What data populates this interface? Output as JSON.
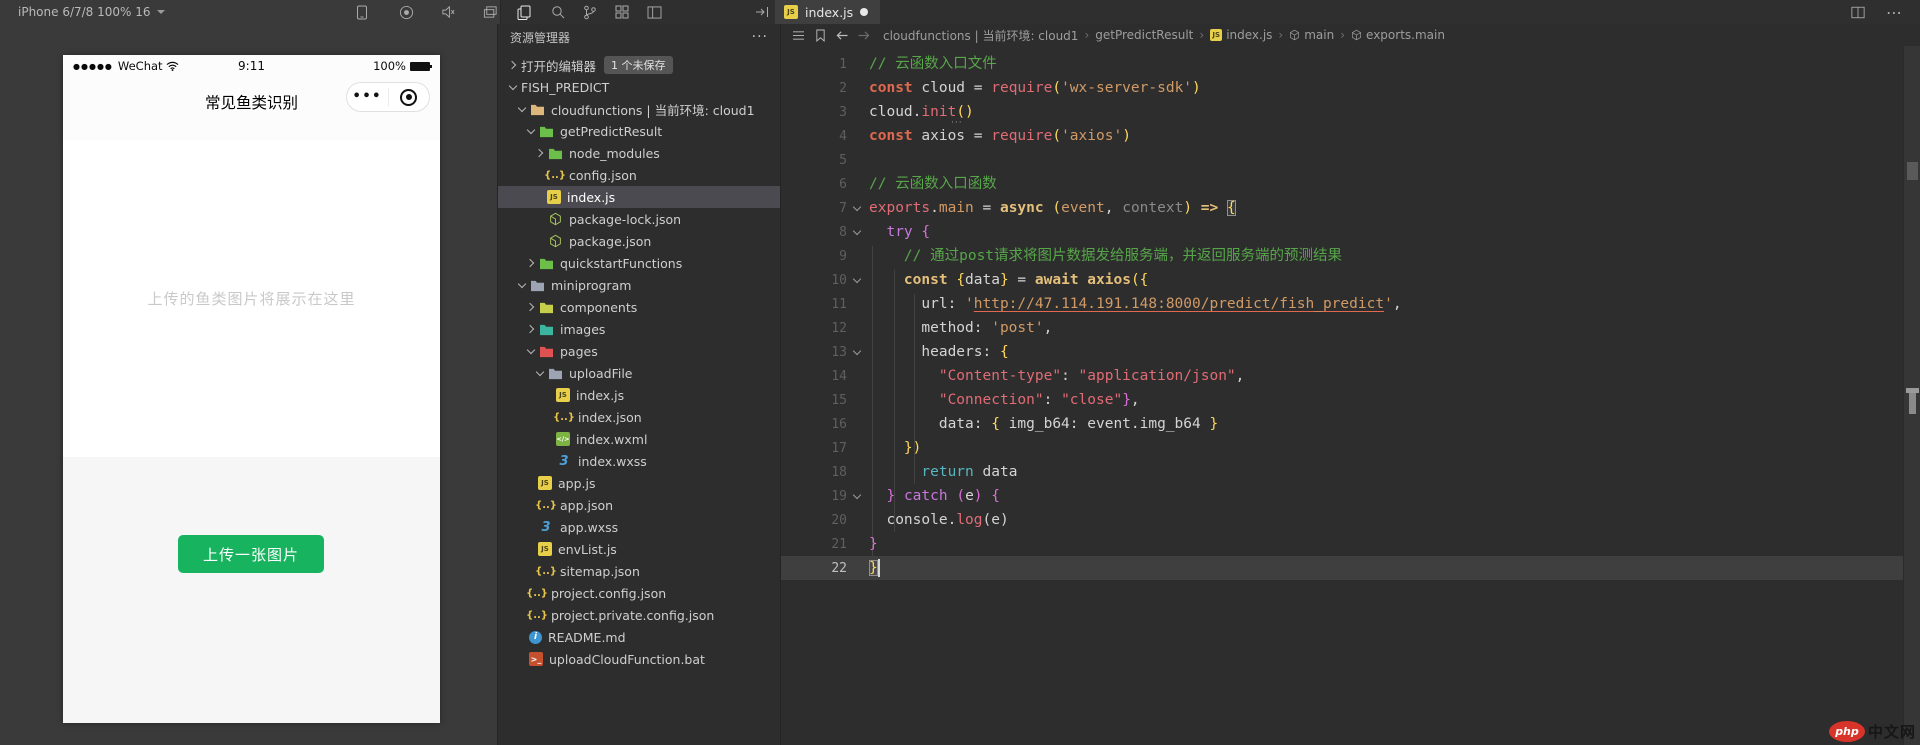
{
  "toolbar": {
    "device_label": "iPhone 6/7/8 100% 16",
    "icons": [
      "phone-icon",
      "record-icon",
      "mute-icon",
      "windows-icon",
      "files-icon",
      "search-icon",
      "git-branch-icon",
      "extensions-icon",
      "layout-icon",
      "collapse-sidebar-icon",
      "split-editor-icon",
      "more-icon"
    ]
  },
  "tab": {
    "label": "index.js",
    "modified": true
  },
  "breadcrumb_icons": [
    "list-icon",
    "bookmark-icon",
    "arrow-back-icon",
    "arrow-forward-icon"
  ],
  "breadcrumbs": [
    {
      "label": "cloudfunctions | 当前环境: cloud1",
      "icon": "none"
    },
    {
      "label": "getPredictResult",
      "icon": "none"
    },
    {
      "label": "index.js",
      "icon": "js"
    },
    {
      "label": "main",
      "icon": "cube"
    },
    {
      "label": "exports.main",
      "icon": "cube"
    }
  ],
  "simulator": {
    "carrier": "WeChat",
    "signal_dots": "●●●●●",
    "time": "9:11",
    "battery": "100%",
    "page_title": "常见鱼类识别",
    "capsule_dots": "•••",
    "placeholder": "上传的鱼类图片将展示在这里",
    "upload_button": "上传一张图片"
  },
  "explorer": {
    "title": "资源管理器",
    "more": "···",
    "open_editors": "打开的编辑器",
    "unsaved_badge": "1 个未保存",
    "items": [
      {
        "label": "FISH_PREDICT",
        "level": 0,
        "arrow": "open",
        "icon": "none"
      },
      {
        "label": "cloudfunctions | 当前环境: cloud1",
        "level": 1,
        "arrow": "open",
        "icon": "folder",
        "color": "#dcb67a"
      },
      {
        "label": "getPredictResult",
        "level": 2,
        "arrow": "open",
        "icon": "folder",
        "color": "#6cc04a"
      },
      {
        "label": "node_modules",
        "level": 3,
        "arrow": "closed",
        "icon": "folder",
        "color": "#6cc04a"
      },
      {
        "label": "config.json",
        "level": 3,
        "arrow": "none",
        "icon": "json"
      },
      {
        "label": "index.js",
        "level": 3,
        "arrow": "none",
        "icon": "js",
        "selected": true
      },
      {
        "label": "package-lock.json",
        "level": 3,
        "arrow": "none",
        "icon": "npm"
      },
      {
        "label": "package.json",
        "level": 3,
        "arrow": "none",
        "icon": "npm"
      },
      {
        "label": "quickstartFunctions",
        "level": 2,
        "arrow": "closed",
        "icon": "folder",
        "color": "#6cc04a"
      },
      {
        "label": "miniprogram",
        "level": 1,
        "arrow": "open",
        "icon": "folder",
        "color": "#9da5b4"
      },
      {
        "label": "components",
        "level": 2,
        "arrow": "closed",
        "icon": "folder",
        "color": "#c5cf4a"
      },
      {
        "label": "images",
        "level": 2,
        "arrow": "closed",
        "icon": "folder",
        "color": "#3cb5a0"
      },
      {
        "label": "pages",
        "level": 2,
        "arrow": "open",
        "icon": "folder",
        "color": "#e05252"
      },
      {
        "label": "uploadFile",
        "level": 3,
        "arrow": "open",
        "icon": "folder",
        "color": "#9da5b4"
      },
      {
        "label": "index.js",
        "level": 4,
        "arrow": "none",
        "icon": "js"
      },
      {
        "label": "index.json",
        "level": 4,
        "arrow": "none",
        "icon": "json"
      },
      {
        "label": "index.wxml",
        "level": 4,
        "arrow": "none",
        "icon": "wxml"
      },
      {
        "label": "index.wxss",
        "level": 4,
        "arrow": "none",
        "icon": "wxss"
      },
      {
        "label": "app.js",
        "level": 2,
        "arrow": "none",
        "icon": "js"
      },
      {
        "label": "app.json",
        "level": 2,
        "arrow": "none",
        "icon": "json"
      },
      {
        "label": "app.wxss",
        "level": 2,
        "arrow": "none",
        "icon": "wxss"
      },
      {
        "label": "envList.js",
        "level": 2,
        "arrow": "none",
        "icon": "js"
      },
      {
        "label": "sitemap.json",
        "level": 2,
        "arrow": "none",
        "icon": "json"
      },
      {
        "label": "project.config.json",
        "level": 1,
        "arrow": "none",
        "icon": "json"
      },
      {
        "label": "project.private.config.json",
        "level": 1,
        "arrow": "none",
        "icon": "json"
      },
      {
        "label": "README.md",
        "level": 1,
        "arrow": "none",
        "icon": "md"
      },
      {
        "label": "uploadCloudFunction.bat",
        "level": 1,
        "arrow": "none",
        "icon": "bat"
      }
    ]
  },
  "code": {
    "lines": [
      {
        "seg": [
          [
            "cm",
            "// 云函数入口文件"
          ]
        ]
      },
      {
        "seg": [
          [
            "kw",
            "const"
          ],
          [
            "id",
            " cloud = "
          ],
          [
            "fn",
            "require"
          ],
          [
            "b1",
            "("
          ],
          [
            "st",
            "'wx-server-sdk'"
          ],
          [
            "b1",
            ")"
          ]
        ]
      },
      {
        "seg": [
          [
            "id",
            "cloud."
          ],
          [
            "fn",
            "init"
          ],
          [
            "b1",
            "()"
          ]
        ]
      },
      {
        "seg": [
          [
            "kw",
            "const"
          ],
          [
            "id",
            " axios = "
          ],
          [
            "fn",
            "require"
          ],
          [
            "b1",
            "("
          ],
          [
            "st",
            "'axios'"
          ],
          [
            "b1",
            ")"
          ]
        ]
      },
      {
        "seg": []
      },
      {
        "seg": [
          [
            "cm",
            "// 云函数入口函数"
          ]
        ]
      },
      {
        "fold": true,
        "seg": [
          [
            "fn",
            "exports"
          ],
          [
            "id",
            "."
          ],
          [
            "st",
            "main"
          ],
          [
            "id",
            " = "
          ],
          [
            "kwy",
            "async"
          ],
          [
            "id",
            " "
          ],
          [
            "b1",
            "("
          ],
          [
            "st",
            "event"
          ],
          [
            "id",
            ", "
          ],
          [
            "dim",
            "context"
          ],
          [
            "b1",
            ")"
          ],
          [
            "id",
            " "
          ],
          [
            "kwy",
            "=>"
          ],
          [
            "id",
            " "
          ],
          [
            "b1m",
            "{"
          ]
        ]
      },
      {
        "fold": true,
        "seg": [
          [
            "id",
            "  "
          ],
          [
            "pu",
            "try"
          ],
          [
            "id",
            " "
          ],
          [
            "b2",
            "{"
          ]
        ]
      },
      {
        "seg": [
          [
            "id",
            "    "
          ],
          [
            "cm",
            "// 通过post请求将图片数据发给服务端，并返回服务端的预测结果"
          ]
        ]
      },
      {
        "fold": true,
        "seg": [
          [
            "id",
            "    "
          ],
          [
            "kwy",
            "const"
          ],
          [
            "id",
            " "
          ],
          [
            "b1",
            "{"
          ],
          [
            "id",
            "data"
          ],
          [
            "b1",
            "}"
          ],
          [
            "id",
            " = "
          ],
          [
            "kwy",
            "await"
          ],
          [
            "id",
            " "
          ],
          [
            "kwy",
            "axios"
          ],
          [
            "b1",
            "({"
          ]
        ]
      },
      {
        "seg": [
          [
            "id",
            "      url: "
          ],
          [
            "st",
            "'"
          ],
          [
            "lk",
            "http://47.114.191.148:8000/predict/fish_predict"
          ],
          [
            "st",
            "'"
          ],
          [
            "id",
            ","
          ]
        ]
      },
      {
        "seg": [
          [
            "id",
            "      method: "
          ],
          [
            "st",
            "'post'"
          ],
          [
            "id",
            ","
          ]
        ]
      },
      {
        "fold": true,
        "seg": [
          [
            "id",
            "      headers: "
          ],
          [
            "b1",
            "{"
          ]
        ]
      },
      {
        "seg": [
          [
            "id",
            "        "
          ],
          [
            "st2",
            "\"Content-type\""
          ],
          [
            "id",
            ": "
          ],
          [
            "st2",
            "\"application/json\""
          ],
          [
            "id",
            ","
          ]
        ]
      },
      {
        "seg": [
          [
            "id",
            "        "
          ],
          [
            "st2",
            "\"Connection\""
          ],
          [
            "id",
            ": "
          ],
          [
            "st2",
            "\"close\""
          ],
          [
            "b2",
            "}"
          ],
          [
            "id",
            ","
          ]
        ]
      },
      {
        "seg": [
          [
            "id",
            "        data: "
          ],
          [
            "b1",
            "{"
          ],
          [
            "id",
            " img_b64: event.img_b64 "
          ],
          [
            "b1",
            "}"
          ]
        ]
      },
      {
        "seg": [
          [
            "id",
            "    "
          ],
          [
            "b1",
            "})"
          ]
        ]
      },
      {
        "seg": [
          [
            "id",
            "      "
          ],
          [
            "te",
            "return"
          ],
          [
            "id",
            " data"
          ]
        ]
      },
      {
        "fold": true,
        "seg": [
          [
            "id",
            "  "
          ],
          [
            "b2",
            "}"
          ],
          [
            "id",
            " "
          ],
          [
            "pu",
            "catch"
          ],
          [
            "id",
            " "
          ],
          [
            "b2",
            "("
          ],
          [
            "id",
            "e"
          ],
          [
            "b2",
            ")"
          ],
          [
            "id",
            " "
          ],
          [
            "b2",
            "{"
          ]
        ]
      },
      {
        "seg": [
          [
            "id",
            "  console."
          ],
          [
            "fn",
            "log"
          ],
          [
            "id",
            "("
          ],
          [
            "id",
            "e"
          ],
          [
            "id",
            ")"
          ]
        ]
      },
      {
        "seg": [
          [
            "b2",
            "}"
          ]
        ]
      },
      {
        "cur": true,
        "seg": [
          [
            "b1m",
            "}"
          ]
        ]
      }
    ]
  },
  "watermark": {
    "logo": "php",
    "text": "中文网"
  },
  "colors": {
    "wechat_green": "#17b35f",
    "php_red": "#d8342a",
    "editor_bg": "#2d2d2d",
    "topbar_bg": "#3a3a3a",
    "selection_bg": "#4a4a50",
    "comment": "#57a64a",
    "string": "#d19a66",
    "keyword": "#e0694f"
  }
}
